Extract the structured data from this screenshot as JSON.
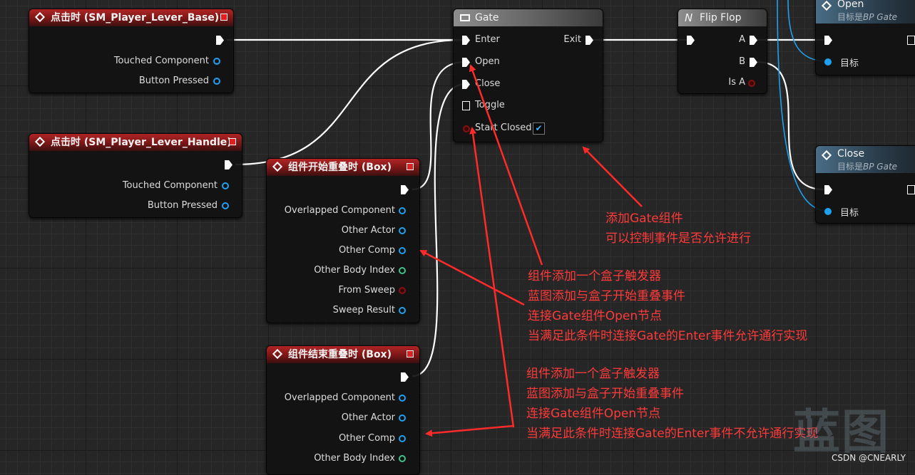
{
  "nodes": {
    "touch_base": {
      "title": "点击时 (SM_Player_Lever_Base)",
      "pins": [
        "Touched Component",
        "Button Pressed"
      ]
    },
    "touch_handle": {
      "title": "点击时 (SM_Player_Lever_Handle)",
      "pins": [
        "Touched Component",
        "Button Pressed"
      ]
    },
    "overlap_begin": {
      "title": "组件开始重叠时 (Box)",
      "pins": [
        "Overlapped Component",
        "Other Actor",
        "Other Comp",
        "Other Body Index",
        "From Sweep",
        "Sweep Result"
      ]
    },
    "overlap_end": {
      "title": "组件结束重叠时 (Box)",
      "pins": [
        "Overlapped Component",
        "Other Actor",
        "Other Comp",
        "Other Body Index"
      ]
    },
    "gate": {
      "title": "Gate",
      "enter": "Enter",
      "exit": "Exit",
      "open": "Open",
      "close": "Close",
      "toggle": "Toggle",
      "start_closed": "Start Closed",
      "start_closed_checked": true
    },
    "flipflop": {
      "title": "Flip Flop",
      "a": "A",
      "b": "B",
      "is_a": "Is A"
    },
    "open_fn": {
      "title": "Open",
      "subtitle_prefix": "目标是",
      "subtitle_target": "BP Gate",
      "target_pin": "目标"
    },
    "close_fn": {
      "title": "Close",
      "subtitle_prefix": "目标是",
      "subtitle_target": "BP Gate",
      "target_pin": "目标"
    }
  },
  "annotations": {
    "gate_note": [
      "添加Gate组件",
      "可以控制事件是否允许进行"
    ],
    "begin_note": [
      "组件添加一个盒子触发器",
      "蓝图添加与盒子开始重叠事件",
      "连接Gate组件Open节点",
      "当满足此条件时连接Gate的Enter事件允许通行实现"
    ],
    "end_note": [
      "组件添加一个盒子触发器",
      "蓝图添加与盒子开始重叠事件",
      "连接Gate组件Open节点",
      "当满足此条件时连接Gate的Enter事件不允许通行实现"
    ]
  },
  "watermark": "蓝图",
  "credit": "CSDN @CNEARLY",
  "colors": {
    "event_header": "#b02525",
    "object_pin": "#1fa0f0",
    "int_pin": "#3fc08a",
    "bool_pin": "#8a1010",
    "annotation": "#ff3a3a",
    "wire": "#ffffff",
    "target_wire": "#1fa0f0"
  }
}
